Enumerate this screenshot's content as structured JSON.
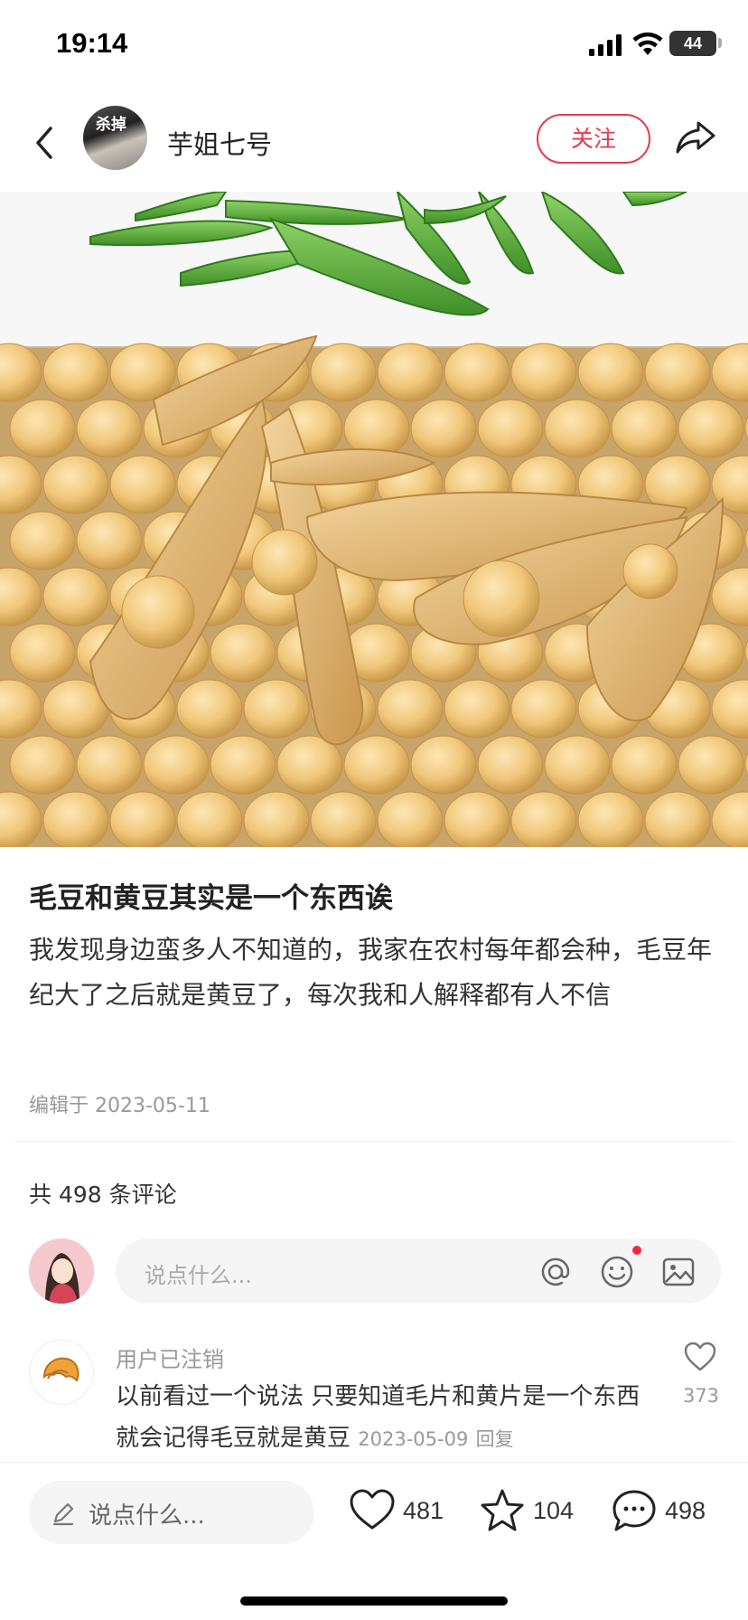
{
  "status_bar": {
    "time": "19:14",
    "battery": "44"
  },
  "header": {
    "author_name": "芋姐七号",
    "avatar_text": "杀掉",
    "follow_label": "关注"
  },
  "post": {
    "title": "毛豆和黄豆其实是一个东西诶",
    "body": "我发现身边蛮多人不知道的，我家在农村每年都会种，毛豆年纪大了之后就是黄豆了，每次我和人解释都有人不信",
    "edited": "编辑于 2023-05-11"
  },
  "comments": {
    "count_label": "共 498 条评论",
    "input_placeholder": "说点什么...",
    "items": [
      {
        "user": "用户已注销",
        "text": "以前看过一个说法 只要知道毛片和黄片是一个东西 就会记得毛豆就是黄豆",
        "date": "2023-05-09",
        "reply_label": "回复",
        "likes": "373"
      }
    ]
  },
  "bottom_bar": {
    "placeholder": "说点什么...",
    "likes": "481",
    "favorites": "104",
    "comments": "498"
  },
  "colors": {
    "accent": "#e8394b",
    "notification_dot": "#ff2442"
  }
}
